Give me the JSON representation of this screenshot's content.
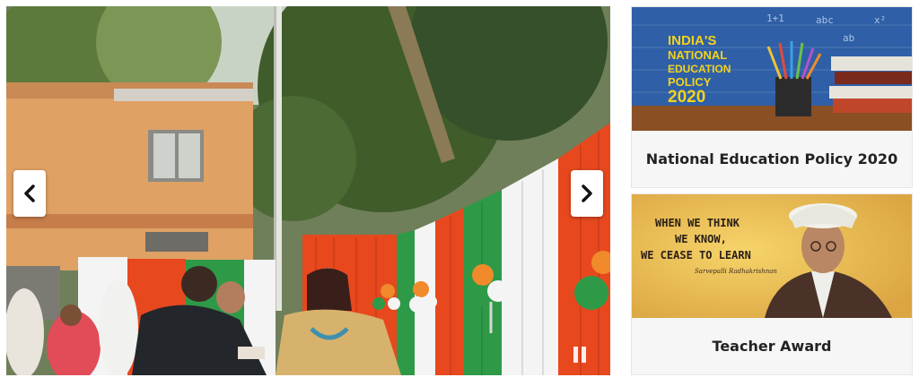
{
  "slider": {
    "prev_icon": "chevron-left-icon",
    "next_icon": "chevron-right-icon",
    "pause_icon": "pause-icon",
    "flag_colors": {
      "saffron": "#e8481e",
      "white": "#f4f4f4",
      "green": "#2e9a48"
    }
  },
  "cards": [
    {
      "image_text": [
        "INDIA'S",
        "NATIONAL",
        "EDUCATION",
        "POLICY",
        "2020"
      ],
      "chalk_text": [
        "1+1",
        "abc",
        "ab",
        "x²"
      ],
      "caption": "National Education Policy 2020"
    },
    {
      "quote_lines": [
        "WHEN WE THINK",
        "WE KNOW,",
        "WE CEASE TO LEARN"
      ],
      "signature": "Sarvepalli Radhakrishnan",
      "caption": "Teacher Award"
    }
  ]
}
